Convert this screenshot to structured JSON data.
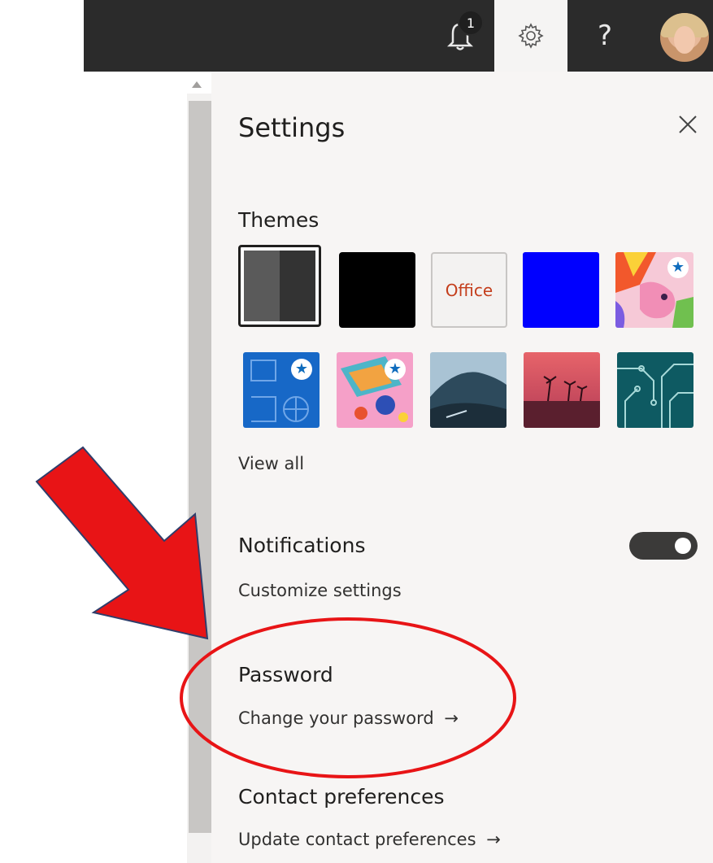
{
  "topbar": {
    "notification_count": "1",
    "help_label": "?"
  },
  "panel": {
    "title": "Settings",
    "themes": {
      "heading": "Themes",
      "office_tile_label": "Office",
      "view_all": "View all"
    },
    "notifications": {
      "heading": "Notifications",
      "link": "Customize settings",
      "toggle_on": true
    },
    "password": {
      "heading": "Password",
      "link": "Change your password",
      "arrow": "→"
    },
    "contact": {
      "heading": "Contact preferences",
      "link": "Update contact preferences",
      "arrow": "→"
    }
  },
  "annotation": {
    "arrow_color": "#e81416",
    "circle_color": "#e81416"
  }
}
